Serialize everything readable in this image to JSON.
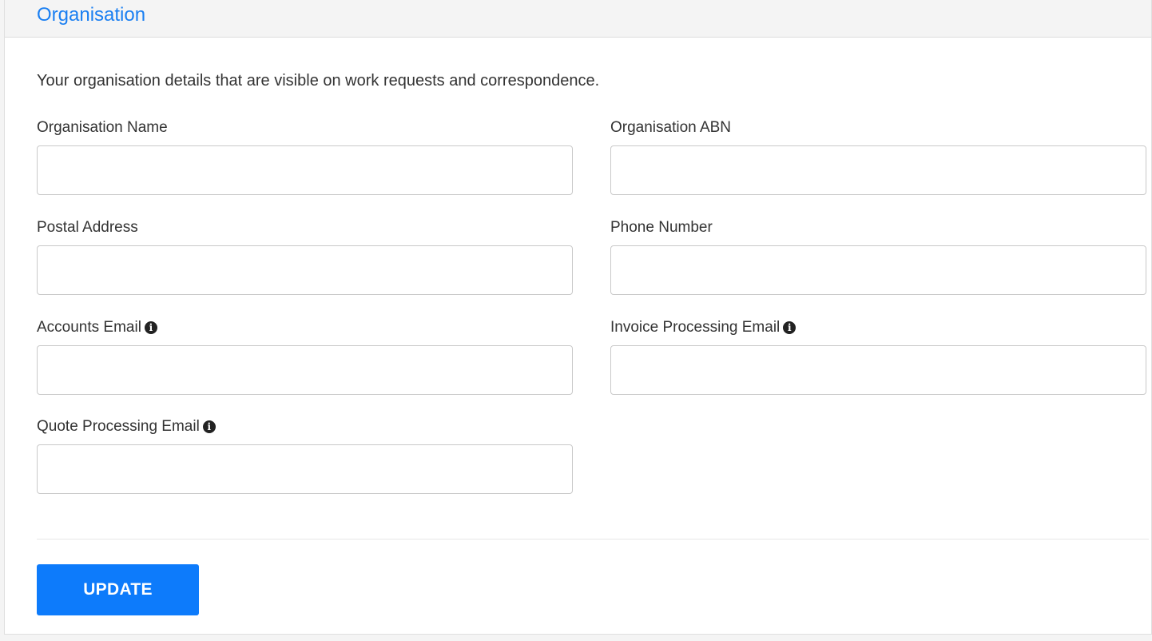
{
  "header": {
    "title": "Organisation"
  },
  "intro_text": "Your organisation details that are visible on work requests and correspondence.",
  "fields": {
    "org_name": {
      "label": "Organisation Name",
      "value": "",
      "placeholder": ""
    },
    "org_abn": {
      "label": "Organisation ABN",
      "value": "",
      "placeholder": ""
    },
    "postal_address": {
      "label": "Postal Address",
      "value": "",
      "placeholder": ""
    },
    "phone_number": {
      "label": "Phone Number",
      "value": "",
      "placeholder": ""
    },
    "accounts_email": {
      "label": "Accounts Email",
      "value": "",
      "placeholder": "",
      "info_icon": "info-circle-icon"
    },
    "invoice_email": {
      "label": "Invoice Processing Email",
      "value": "",
      "placeholder": "",
      "info_icon": "info-circle-icon"
    },
    "quote_email": {
      "label": "Quote Processing Email",
      "value": "",
      "placeholder": "",
      "info_icon": "info-circle-icon"
    }
  },
  "actions": {
    "update_label": "UPDATE"
  },
  "colors": {
    "accent": "#1a7ff2",
    "button": "#0d7bfb",
    "header_bg": "#f4f4f4"
  }
}
